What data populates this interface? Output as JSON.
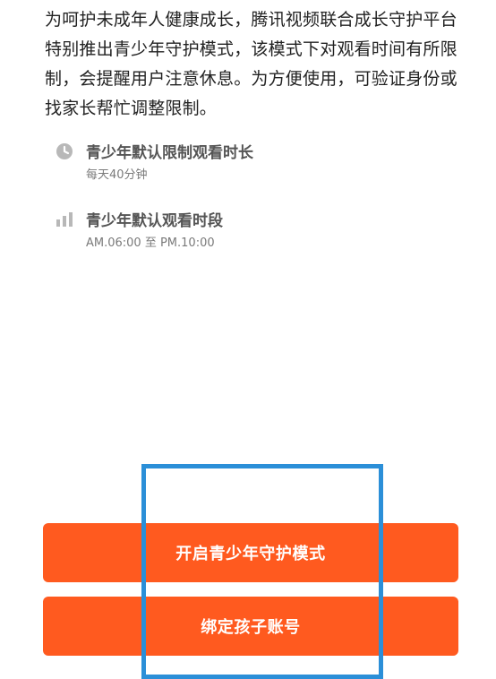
{
  "intro": {
    "text": "为呵护未成年人健康成长，腾讯视频联合成长守护平台特别推出青少年守护模式，该模式下对观看时间有所限制，会提醒用户注意休息。为方便使用，可验证身份或找家长帮忙调整限制。"
  },
  "info": {
    "items": [
      {
        "icon": "clock-icon",
        "title": "青少年默认限制观看时长",
        "subtitle": "每天40分钟"
      },
      {
        "icon": "bar-chart-icon",
        "title": "青少年默认观看时段",
        "subtitle": "AM.06:00 至 PM.10:00"
      }
    ]
  },
  "actions": {
    "primary_label": "开启青少年守护模式",
    "secondary_label": "绑定孩子账号"
  },
  "colors": {
    "accent": "#ff5a1f",
    "highlight": "#2b8fd8",
    "icon_gray": "#b8b8b8"
  }
}
